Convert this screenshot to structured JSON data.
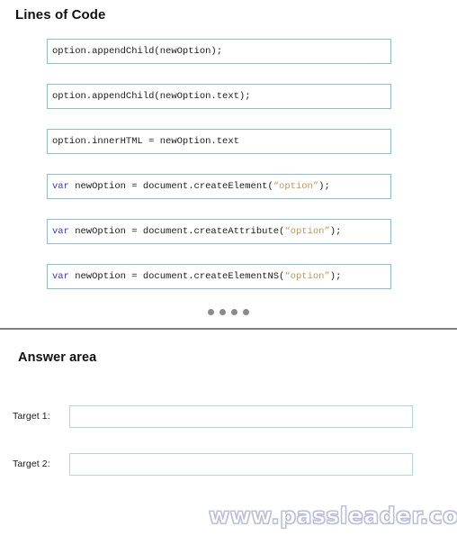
{
  "sections": {
    "lines_of_code": {
      "title": "Lines of Code"
    },
    "answer_area": {
      "title": "Answer area"
    }
  },
  "code_options": [
    {
      "id": "code-option-1",
      "plain_text": "option.appendChild(newOption);",
      "tokens": [
        {
          "type": "plain",
          "text": "option.appendChild(newOption);"
        }
      ]
    },
    {
      "id": "code-option-2",
      "plain_text": "option.appendChild(newOption.text);",
      "tokens": [
        {
          "type": "plain",
          "text": "option.appendChild(newOption.text);"
        }
      ]
    },
    {
      "id": "code-option-3",
      "plain_text": "option.innerHTML = newOption.text",
      "tokens": [
        {
          "type": "plain",
          "text": "option.innerHTML = newOption.text"
        }
      ]
    },
    {
      "id": "code-option-4",
      "plain_text": "var newOption = document.createElement(\"option\");",
      "tokens": [
        {
          "type": "keyword",
          "text": "var"
        },
        {
          "type": "plain",
          "text": " newOption = document.createElement("
        },
        {
          "type": "string",
          "text": "“option”"
        },
        {
          "type": "plain",
          "text": ");"
        }
      ]
    },
    {
      "id": "code-option-5",
      "plain_text": "var newOption = document.createAttribute(\"option\");",
      "tokens": [
        {
          "type": "keyword",
          "text": "var"
        },
        {
          "type": "plain",
          "text": " newOption = document.createAttribute("
        },
        {
          "type": "string",
          "text": "“option”"
        },
        {
          "type": "plain",
          "text": ");"
        }
      ]
    },
    {
      "id": "code-option-6",
      "plain_text": "var newOption = document.createElementNS(\"option\");",
      "tokens": [
        {
          "type": "keyword",
          "text": "var"
        },
        {
          "type": "plain",
          "text": " newOption = document.createElementNS("
        },
        {
          "type": "string",
          "text": "“option”"
        },
        {
          "type": "plain",
          "text": ");"
        }
      ]
    }
  ],
  "separator": {
    "dot_count": 4,
    "dot_color": "#8a8a8a",
    "rule_color": "#7e7e7e"
  },
  "answer_targets": [
    {
      "label": "Target 1:",
      "value": ""
    },
    {
      "label": "Target 2:",
      "value": ""
    }
  ],
  "watermark": {
    "text": "www.passleader.com"
  },
  "colors": {
    "code_box_border": "#8cbfcb",
    "dropzone_border": "#b4d6e0",
    "keyword": "#3636cf",
    "string": "#c59457",
    "text": "#1a1a1a"
  }
}
